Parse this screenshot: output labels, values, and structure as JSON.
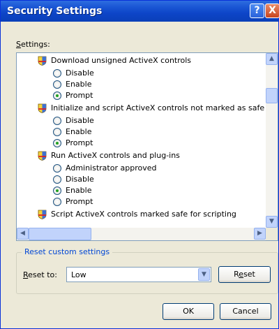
{
  "window": {
    "title": "Security Settings",
    "help_glyph": "?",
    "close_glyph": "X"
  },
  "settings_label": {
    "first": "S",
    "rest": "ettings:"
  },
  "groups": [
    {
      "title": "Download unsigned ActiveX controls",
      "options": [
        {
          "label": "Disable",
          "selected": false
        },
        {
          "label": "Enable",
          "selected": false
        },
        {
          "label": "Prompt",
          "selected": true
        }
      ]
    },
    {
      "title": "Initialize and script ActiveX controls not marked as safe",
      "options": [
        {
          "label": "Disable",
          "selected": false
        },
        {
          "label": "Enable",
          "selected": false
        },
        {
          "label": "Prompt",
          "selected": true
        }
      ]
    },
    {
      "title": "Run ActiveX controls and plug-ins",
      "options": [
        {
          "label": "Administrator approved",
          "selected": false
        },
        {
          "label": "Disable",
          "selected": false
        },
        {
          "label": "Enable",
          "selected": true
        },
        {
          "label": "Prompt",
          "selected": false
        }
      ]
    },
    {
      "title": "Script ActiveX controls marked safe for scripting",
      "options": []
    }
  ],
  "scroll_glyphs": {
    "up": "▲",
    "down": "▼",
    "left": "◀",
    "right": "▶"
  },
  "reset_group": {
    "title": "Reset custom settings",
    "reset_to_first": "R",
    "reset_to_rest": "eset to:",
    "selected_level": "Low",
    "dropdown_glyph": "▼",
    "reset_button": {
      "before": "R",
      "underlined": "e",
      "after": "set"
    }
  },
  "ok_label": "OK",
  "cancel_label": "Cancel",
  "colors": {
    "title_bar": "#0a3fb8",
    "group_title": "#0046d5",
    "radio_dot": "#21a121"
  }
}
